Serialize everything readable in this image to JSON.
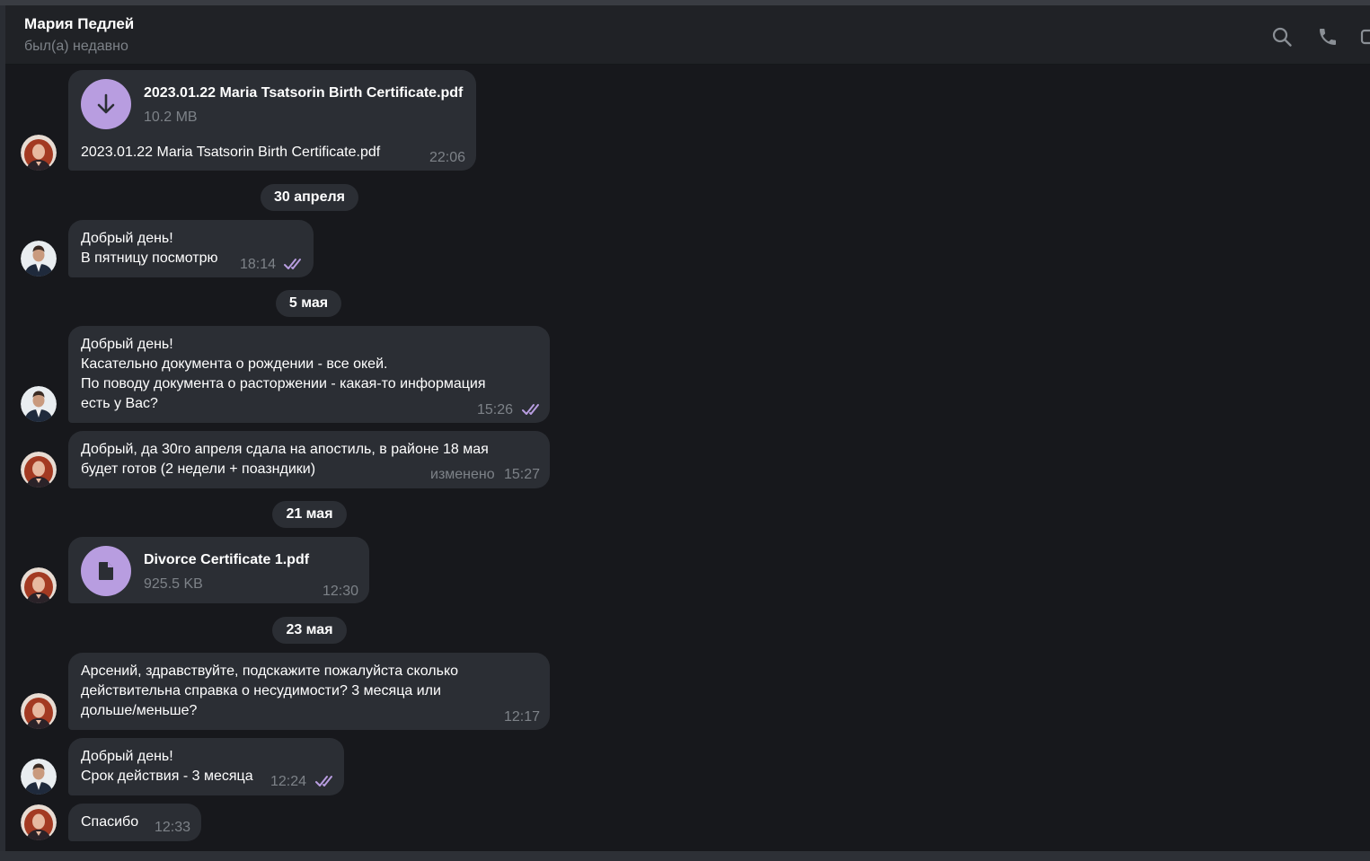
{
  "header": {
    "contact_name": "Мария Педлей",
    "status": "был(а) недавно",
    "icons": [
      "search-icon",
      "phone-icon",
      "video-icon"
    ]
  },
  "colors": {
    "accent": "#b89de0",
    "bubble": "#2b2e34",
    "chat_bg": "#17181c",
    "meta_text": "#7d8288"
  },
  "messages": [
    {
      "type": "file",
      "sender": "maria",
      "file_name": "2023.01.22 Maria Tsatsorin Birth Certificate.pdf",
      "file_size": "10.2 MB",
      "file_icon": "download-icon",
      "caption": "2023.01.22 Maria Tsatsorin Birth Certificate.pdf",
      "time": "22:06"
    },
    {
      "type": "date",
      "label": "30 апреля"
    },
    {
      "type": "text",
      "sender": "arseniy",
      "lines": [
        "Добрый день!",
        "В пятницу посмотрю"
      ],
      "time": "18:14",
      "read": true
    },
    {
      "type": "date",
      "label": "5 мая"
    },
    {
      "type": "text",
      "sender": "arseniy",
      "lines": [
        "Добрый день!",
        "Касательно документа о рождении - все окей.",
        "По поводу документа о расторжении - какая-то информация",
        "есть у Вас?"
      ],
      "time": "15:26",
      "read": true
    },
    {
      "type": "text",
      "sender": "maria",
      "lines": [
        "Добрый, да 30го апреля сдала на апостиль, в районе 18 мая",
        "будет готов (2 недели + поазндики)"
      ],
      "edited_label": "изменено",
      "time": "15:27"
    },
    {
      "type": "date",
      "label": "21 мая"
    },
    {
      "type": "file",
      "sender": "maria",
      "file_name": "Divorce Certificate 1.pdf",
      "file_size": "925.5 KB",
      "file_icon": "document-icon",
      "time": "12:30"
    },
    {
      "type": "date",
      "label": "23 мая"
    },
    {
      "type": "text",
      "sender": "maria",
      "lines": [
        "Арсений, здравствуйте, подскажите пожалуйста сколько",
        "действительна справка о несудимости? 3 месяца или",
        "дольше/меньше?"
      ],
      "time": "12:17"
    },
    {
      "type": "text",
      "sender": "arseniy",
      "lines": [
        "Добрый день!",
        "Срок действия - 3 месяца"
      ],
      "time": "12:24",
      "read": true
    },
    {
      "type": "text",
      "sender": "maria",
      "lines": [
        "Спасибо"
      ],
      "time": "12:33"
    }
  ]
}
